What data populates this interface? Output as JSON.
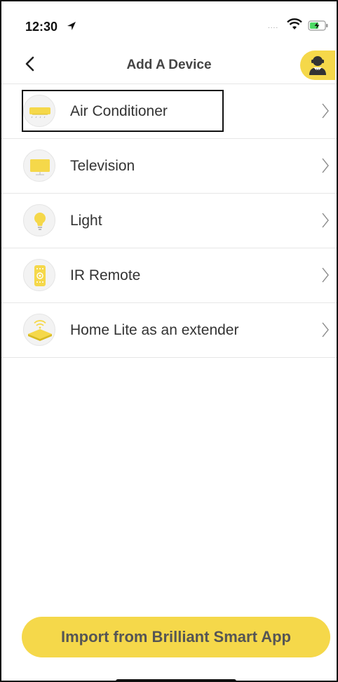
{
  "status_bar": {
    "time": "12:30"
  },
  "nav": {
    "title": "Add A Device"
  },
  "devices": [
    {
      "label": "Air Conditioner",
      "icon": "air-conditioner-icon"
    },
    {
      "label": "Television",
      "icon": "television-icon"
    },
    {
      "label": "Light",
      "icon": "light-bulb-icon"
    },
    {
      "label": "IR Remote",
      "icon": "ir-remote-icon"
    },
    {
      "label": "Home Lite as an extender",
      "icon": "wifi-extender-icon"
    }
  ],
  "import_button": {
    "label": "Import from Brilliant Smart App"
  },
  "colors": {
    "accent": "#f5d84a",
    "divider": "#e6e6e6"
  }
}
